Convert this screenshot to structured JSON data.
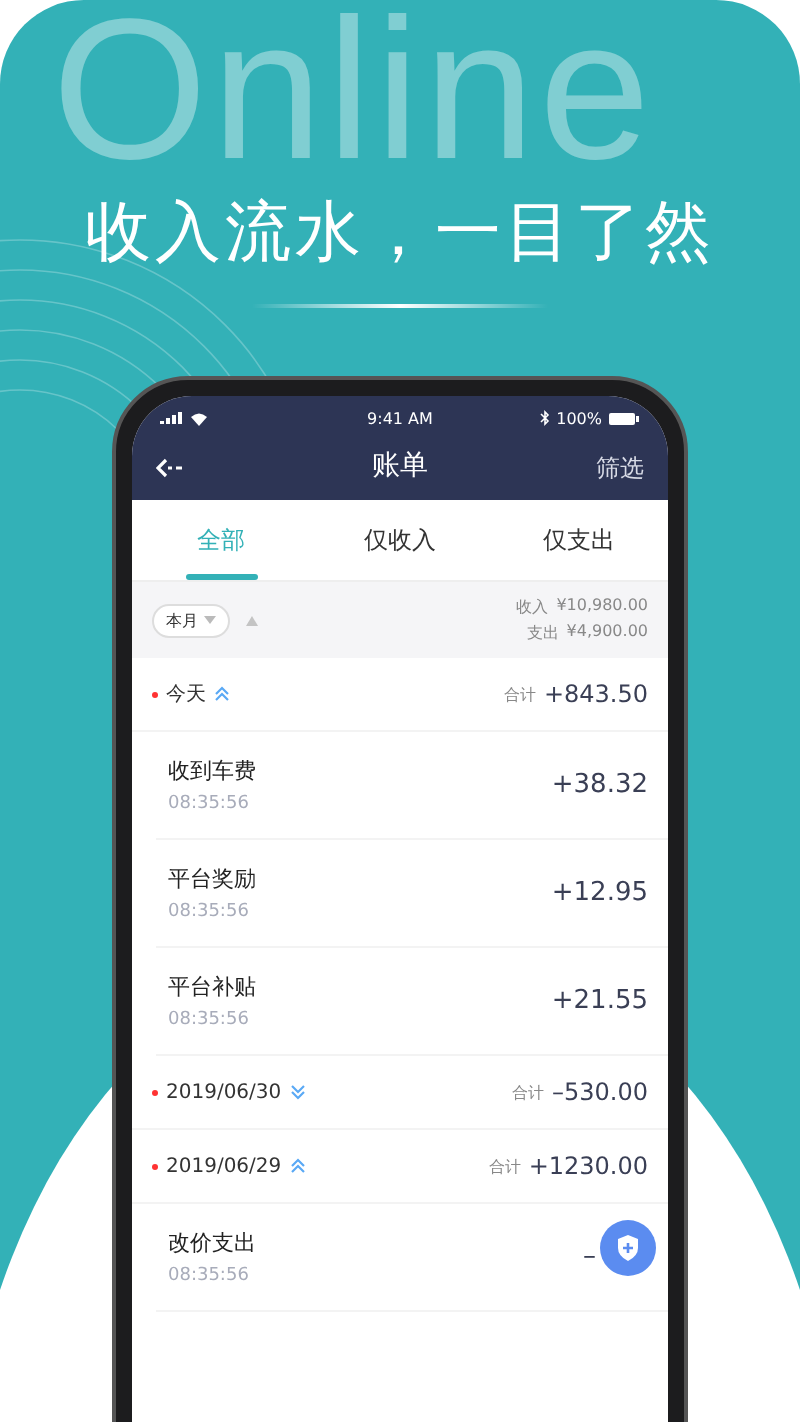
{
  "backdrop_word": "Online",
  "headline": "收入流水，一目了然",
  "status_bar": {
    "time": "9:41 AM",
    "battery": "100%"
  },
  "nav": {
    "title": "账单",
    "action": "筛选"
  },
  "tabs": [
    {
      "label": "全部",
      "selected": true
    },
    {
      "label": "仅收入",
      "selected": false
    },
    {
      "label": "仅支出",
      "selected": false
    }
  ],
  "summary": {
    "period": "本月",
    "income_label": "收入",
    "income": "¥10,980.00",
    "expense_label": "支出",
    "expense": "¥4,900.00"
  },
  "groups": [
    {
      "date": "今天",
      "expanded": true,
      "total_label": "合计",
      "total": "+843.50",
      "items": [
        {
          "name": "收到车费",
          "time": "08:35:56",
          "amount": "+38.32"
        },
        {
          "name": "平台奖励",
          "time": "08:35:56",
          "amount": "+12.95"
        },
        {
          "name": "平台补贴",
          "time": "08:35:56",
          "amount": "+21.55"
        }
      ]
    },
    {
      "date": "2019/06/30",
      "expanded": false,
      "total_label": "合计",
      "total": "–530.00"
    },
    {
      "date": "2019/06/29",
      "expanded": true,
      "total_label": "合计",
      "total": "+1230.00",
      "items": [
        {
          "name": "改价支出",
          "time": "08:35:56",
          "amount": "–"
        }
      ]
    }
  ]
}
